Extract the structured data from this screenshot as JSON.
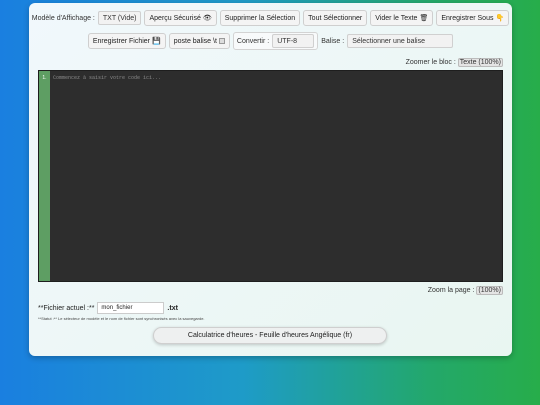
{
  "toolbar": {
    "modele_label": "Modèle d'Affichage :",
    "modele_value": "TXT (Vide)",
    "apercu": "Aperçu Sécurisé",
    "apercu_icon": "👁",
    "supprimer": "Supprimer la Sélection",
    "tout_selectionner": "Tout Sélectionner",
    "vider": "Vider le Texte",
    "vider_icon": "🗑",
    "enregistrer_sous": "Enregistrer Sous",
    "enregistrer_sous_icon": "👇",
    "enregistrer_fichier": "Enregistrer Fichier",
    "enregistrer_fichier_icon": "💾",
    "poste_balise": "poste balise \\t",
    "convertir_label": "Convertir :",
    "convertir_value": "UTF-8",
    "balise_label": "Balise :",
    "balise_value": "Sélectionner une balise"
  },
  "zoom_bloc": {
    "label": "Zoomer le bloc :",
    "value": "Texte (100%)"
  },
  "editor": {
    "line_number": "1.",
    "placeholder": "Commencez à saisir votre code ici..."
  },
  "zoom_page": {
    "label": "Zoom la page :",
    "value": "(100%)"
  },
  "file": {
    "label": "**Fichier actuel :**",
    "name": "mon_fichier",
    "ext": ".txt"
  },
  "status_note": "**Statut :** Le sélecteur de modèle et le nom de fichier sont synchronisés avec la sauvegarde.",
  "calc_button": "Calculatrice d'heures - Feuille d'heures Angélique (fr)"
}
